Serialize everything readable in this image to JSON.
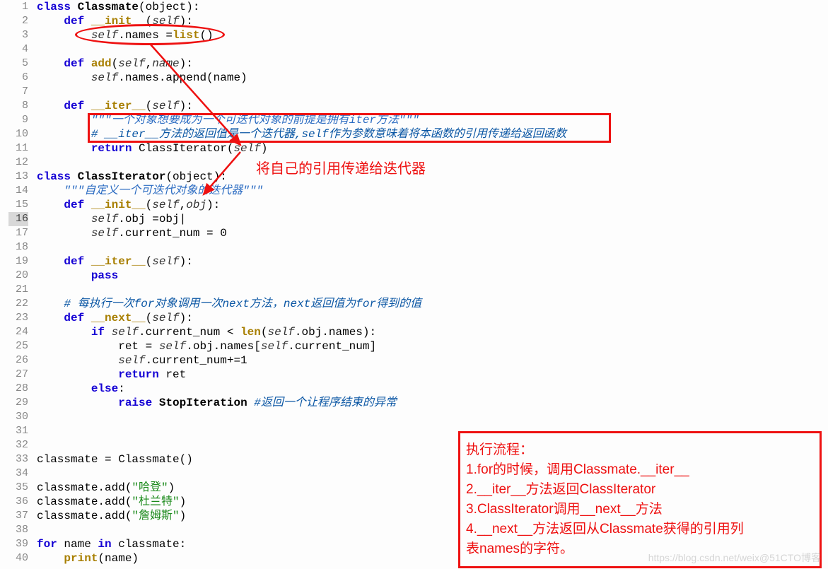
{
  "lines": [
    {
      "n": "1",
      "segs": [
        {
          "t": "class ",
          "c": "kw"
        },
        {
          "t": "Classmate",
          "c": "cls"
        },
        {
          "t": "(object):",
          "c": ""
        }
      ]
    },
    {
      "n": "2",
      "segs": [
        {
          "t": "    ",
          "c": ""
        },
        {
          "t": "def ",
          "c": "kw"
        },
        {
          "t": "__init__",
          "c": "fn"
        },
        {
          "t": "(",
          "c": ""
        },
        {
          "t": "self",
          "c": "self"
        },
        {
          "t": "):",
          "c": ""
        }
      ]
    },
    {
      "n": "3",
      "segs": [
        {
          "t": "        ",
          "c": ""
        },
        {
          "t": "self",
          "c": "self"
        },
        {
          "t": ".names =",
          "c": ""
        },
        {
          "t": "list",
          "c": "builtin"
        },
        {
          "t": "()",
          "c": ""
        }
      ]
    },
    {
      "n": "4",
      "segs": [
        {
          "t": "",
          "c": ""
        }
      ]
    },
    {
      "n": "5",
      "segs": [
        {
          "t": "    ",
          "c": ""
        },
        {
          "t": "def ",
          "c": "kw"
        },
        {
          "t": "add",
          "c": "fn"
        },
        {
          "t": "(",
          "c": ""
        },
        {
          "t": "self",
          "c": "self"
        },
        {
          "t": ",",
          "c": ""
        },
        {
          "t": "name",
          "c": "self"
        },
        {
          "t": "):",
          "c": ""
        }
      ]
    },
    {
      "n": "6",
      "segs": [
        {
          "t": "        ",
          "c": ""
        },
        {
          "t": "self",
          "c": "self"
        },
        {
          "t": ".names.append(name)",
          "c": ""
        }
      ]
    },
    {
      "n": "7",
      "segs": [
        {
          "t": "",
          "c": ""
        }
      ]
    },
    {
      "n": "8",
      "segs": [
        {
          "t": "    ",
          "c": ""
        },
        {
          "t": "def ",
          "c": "kw"
        },
        {
          "t": "__iter__",
          "c": "fn"
        },
        {
          "t": "(",
          "c": ""
        },
        {
          "t": "self",
          "c": "self"
        },
        {
          "t": "):",
          "c": ""
        }
      ]
    },
    {
      "n": "9",
      "segs": [
        {
          "t": "        ",
          "c": ""
        },
        {
          "t": "\"\"\"一个对象想要成为一个可迭代对象的前提是拥有",
          "c": "docstr"
        },
        {
          "t": "iter",
          "c": "docstr"
        },
        {
          "t": "方法\"\"\"",
          "c": "docstr"
        }
      ]
    },
    {
      "n": "10",
      "segs": [
        {
          "t": "        ",
          "c": ""
        },
        {
          "t": "# __iter__方法的返回值是一个迭代器,",
          "c": "comment"
        },
        {
          "t": "self",
          "c": "comment"
        },
        {
          "t": "作为参数意味着将本函数的引用传递给返回函数",
          "c": "comment"
        }
      ]
    },
    {
      "n": "11",
      "segs": [
        {
          "t": "        ",
          "c": ""
        },
        {
          "t": "return",
          "c": "kw"
        },
        {
          "t": " ClassIterator(",
          "c": ""
        },
        {
          "t": "self",
          "c": "self"
        },
        {
          "t": ")",
          "c": ""
        }
      ]
    },
    {
      "n": "12",
      "segs": [
        {
          "t": "",
          "c": ""
        }
      ]
    },
    {
      "n": "13",
      "segs": [
        {
          "t": "class ",
          "c": "kw"
        },
        {
          "t": "ClassIterator",
          "c": "cls"
        },
        {
          "t": "(object):",
          "c": ""
        }
      ]
    },
    {
      "n": "14",
      "segs": [
        {
          "t": "    ",
          "c": ""
        },
        {
          "t": "\"\"\"自定义一个可迭代对象的迭代器\"\"\"",
          "c": "docstr"
        }
      ]
    },
    {
      "n": "15",
      "segs": [
        {
          "t": "    ",
          "c": ""
        },
        {
          "t": "def ",
          "c": "kw"
        },
        {
          "t": "__init__",
          "c": "fn"
        },
        {
          "t": "(",
          "c": ""
        },
        {
          "t": "self",
          "c": "self"
        },
        {
          "t": ",",
          "c": ""
        },
        {
          "t": "obj",
          "c": "self"
        },
        {
          "t": "):",
          "c": ""
        }
      ]
    },
    {
      "n": "16",
      "hl": true,
      "segs": [
        {
          "t": "        ",
          "c": ""
        },
        {
          "t": "self",
          "c": "self"
        },
        {
          "t": ".obj =obj|",
          "c": ""
        }
      ]
    },
    {
      "n": "17",
      "segs": [
        {
          "t": "        ",
          "c": ""
        },
        {
          "t": "self",
          "c": "self"
        },
        {
          "t": ".current_num = 0",
          "c": ""
        }
      ]
    },
    {
      "n": "18",
      "segs": [
        {
          "t": "",
          "c": ""
        }
      ]
    },
    {
      "n": "19",
      "segs": [
        {
          "t": "    ",
          "c": ""
        },
        {
          "t": "def ",
          "c": "kw"
        },
        {
          "t": "__iter__",
          "c": "fn"
        },
        {
          "t": "(",
          "c": ""
        },
        {
          "t": "self",
          "c": "self"
        },
        {
          "t": "):",
          "c": ""
        }
      ]
    },
    {
      "n": "20",
      "segs": [
        {
          "t": "        ",
          "c": ""
        },
        {
          "t": "pass",
          "c": "kw"
        }
      ]
    },
    {
      "n": "21",
      "segs": [
        {
          "t": "",
          "c": ""
        }
      ]
    },
    {
      "n": "22",
      "segs": [
        {
          "t": "    ",
          "c": ""
        },
        {
          "t": "# 每执行一次",
          "c": "comment"
        },
        {
          "t": "for",
          "c": "comment"
        },
        {
          "t": "对象调用一次",
          "c": "comment"
        },
        {
          "t": "next",
          "c": "comment"
        },
        {
          "t": "方法，",
          "c": "comment"
        },
        {
          "t": "next",
          "c": "comment"
        },
        {
          "t": "返回值为",
          "c": "comment"
        },
        {
          "t": "for",
          "c": "comment"
        },
        {
          "t": "得到的值",
          "c": "comment"
        }
      ]
    },
    {
      "n": "23",
      "segs": [
        {
          "t": "    ",
          "c": ""
        },
        {
          "t": "def ",
          "c": "kw"
        },
        {
          "t": "__next__",
          "c": "fn"
        },
        {
          "t": "(",
          "c": ""
        },
        {
          "t": "self",
          "c": "self"
        },
        {
          "t": "):",
          "c": ""
        }
      ]
    },
    {
      "n": "24",
      "segs": [
        {
          "t": "        ",
          "c": ""
        },
        {
          "t": "if",
          "c": "kw"
        },
        {
          "t": " ",
          "c": ""
        },
        {
          "t": "self",
          "c": "self"
        },
        {
          "t": ".current_num < ",
          "c": ""
        },
        {
          "t": "len",
          "c": "builtin"
        },
        {
          "t": "(",
          "c": ""
        },
        {
          "t": "self",
          "c": "self"
        },
        {
          "t": ".obj.names):",
          "c": ""
        }
      ]
    },
    {
      "n": "25",
      "segs": [
        {
          "t": "            ret = ",
          "c": ""
        },
        {
          "t": "self",
          "c": "self"
        },
        {
          "t": ".obj.names[",
          "c": ""
        },
        {
          "t": "self",
          "c": "self"
        },
        {
          "t": ".current_num]",
          "c": ""
        }
      ]
    },
    {
      "n": "26",
      "segs": [
        {
          "t": "            ",
          "c": ""
        },
        {
          "t": "self",
          "c": "self"
        },
        {
          "t": ".current_num+=1",
          "c": ""
        }
      ]
    },
    {
      "n": "27",
      "segs": [
        {
          "t": "            ",
          "c": ""
        },
        {
          "t": "return",
          "c": "kw"
        },
        {
          "t": " ret",
          "c": ""
        }
      ]
    },
    {
      "n": "28",
      "segs": [
        {
          "t": "        ",
          "c": ""
        },
        {
          "t": "else",
          "c": "kw"
        },
        {
          "t": ":",
          "c": ""
        }
      ]
    },
    {
      "n": "29",
      "segs": [
        {
          "t": "            ",
          "c": ""
        },
        {
          "t": "raise",
          "c": "kw"
        },
        {
          "t": " ",
          "c": ""
        },
        {
          "t": "StopIteration",
          "c": "cls"
        },
        {
          "t": " ",
          "c": ""
        },
        {
          "t": "#返回一个让程序结束的异常",
          "c": "comment"
        }
      ]
    },
    {
      "n": "30",
      "segs": [
        {
          "t": "",
          "c": ""
        }
      ]
    },
    {
      "n": "31",
      "segs": [
        {
          "t": "",
          "c": ""
        }
      ]
    },
    {
      "n": "32",
      "segs": [
        {
          "t": "",
          "c": ""
        }
      ]
    },
    {
      "n": "33",
      "segs": [
        {
          "t": "classmate = Classmate()",
          "c": ""
        }
      ]
    },
    {
      "n": "34",
      "segs": [
        {
          "t": "",
          "c": ""
        }
      ]
    },
    {
      "n": "35",
      "segs": [
        {
          "t": "classmate.add(",
          "c": ""
        },
        {
          "t": "\"哈登\"",
          "c": "str"
        },
        {
          "t": ")",
          "c": ""
        }
      ]
    },
    {
      "n": "36",
      "segs": [
        {
          "t": "classmate.add(",
          "c": ""
        },
        {
          "t": "\"杜兰特\"",
          "c": "str"
        },
        {
          "t": ")",
          "c": ""
        }
      ]
    },
    {
      "n": "37",
      "segs": [
        {
          "t": "classmate.add(",
          "c": ""
        },
        {
          "t": "\"詹姆斯\"",
          "c": "str"
        },
        {
          "t": ")",
          "c": ""
        }
      ]
    },
    {
      "n": "38",
      "segs": [
        {
          "t": "",
          "c": ""
        }
      ]
    },
    {
      "n": "39",
      "segs": [
        {
          "t": "for",
          "c": "kw"
        },
        {
          "t": " name ",
          "c": ""
        },
        {
          "t": "in",
          "c": "kw"
        },
        {
          "t": " classmate:",
          "c": ""
        }
      ]
    },
    {
      "n": "40",
      "segs": [
        {
          "t": "    ",
          "c": ""
        },
        {
          "t": "print",
          "c": "builtin"
        },
        {
          "t": "(name)",
          "c": ""
        }
      ]
    }
  ],
  "annotations": {
    "ellipse_target": "self.names =list()",
    "boxed_comment": "__iter__ docstring and comment block",
    "red_label": "将自己的引用传递给迭代器",
    "note_title": "执行流程：",
    "note_items": [
      "1.for的时候，调用Classmate.__iter__",
      "2.__iter__方法返回ClassIterator",
      "3.ClassIterator调用__next__方法",
      "4.__next__方法返回从Classmate获得的引用列",
      "表names的字符。"
    ]
  },
  "watermark": "https://blog.csdn.net/weix@51CTO博客"
}
